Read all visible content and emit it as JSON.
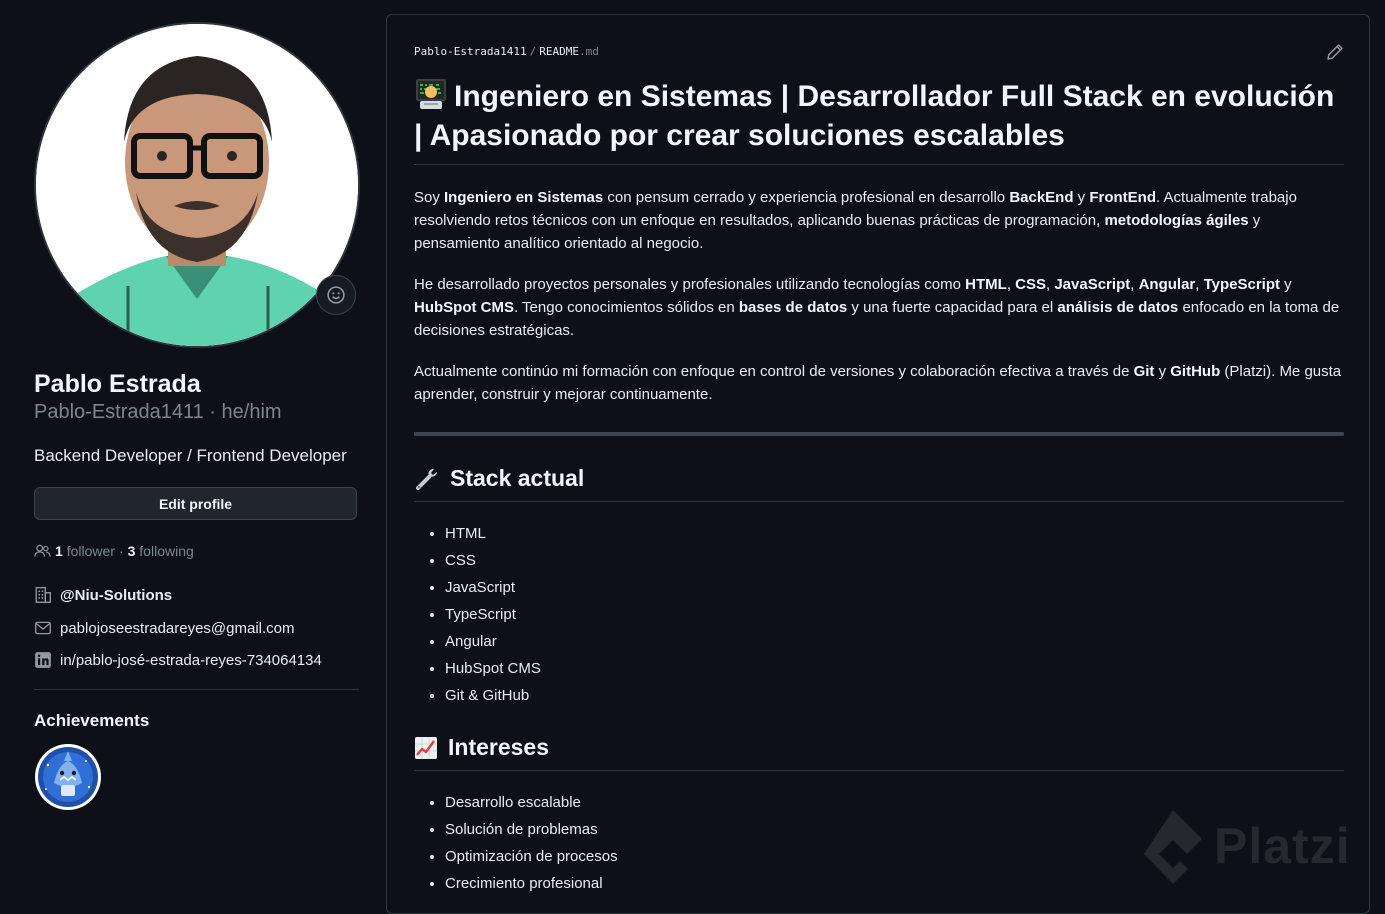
{
  "profile": {
    "name": "Pablo Estrada",
    "login_pronouns": "Pablo-Estrada1411 · he/him",
    "bio": "Backend Developer / Frontend Developer",
    "edit_button": "Edit profile",
    "followers_count": "1",
    "followers_label": "follower",
    "separator": "·",
    "following_count": "3",
    "following_label": "following",
    "organization": "@Niu-Solutions",
    "email": "pablojoseestradareyes@gmail.com",
    "linkedin": "in/pablo-josé-estrada-reyes-734064134",
    "achievements_title": "Achievements"
  },
  "readme": {
    "crumb_owner": "Pablo-Estrada1411",
    "crumb_sep": "/",
    "crumb_file": "README",
    "crumb_ext": ".md",
    "title": "Ingeniero en Sistemas | Desarrollador Full Stack en evolución | Apasionado por crear soluciones escalables",
    "para1": {
      "t1": "Soy ",
      "b1": "Ingeniero en Sistemas",
      "t2": " con pensum cerrado y experiencia profesional en desarrollo ",
      "b2": "BackEnd",
      "t3": " y ",
      "b3": "FrontEnd",
      "t4": ". Actualmente trabajo resolviendo retos técnicos con un enfoque en resultados, aplicando buenas prácticas de programación, ",
      "b4": "metodologías ágiles",
      "t5": " y pensamiento analítico orientado al negocio."
    },
    "para2": {
      "t1": "He desarrollado proyectos personales y profesionales utilizando tecnologías como ",
      "b1": "HTML",
      "t2": ", ",
      "b2": "CSS",
      "t3": ", ",
      "b3": "JavaScript",
      "t4": ", ",
      "b4": "Angular",
      "t5": ", ",
      "b5": "TypeScript",
      "t6": " y ",
      "b6": "HubSpot CMS",
      "t7": ". Tengo conocimientos sólidos en ",
      "b7": "bases de datos",
      "t8": " y una fuerte capacidad para el ",
      "b8": "análisis de datos",
      "t9": " enfocado en la toma de decisiones estratégicas."
    },
    "para3": {
      "t1": "Actualmente continúo mi formación con enfoque en control de versiones y colaboración efectiva a través de ",
      "b1": "Git",
      "t2": " y ",
      "b2": "GitHub",
      "t3": " (Platzi). Me gusta aprender, construir y mejorar continuamente."
    },
    "stack_title": "Stack actual",
    "stack": [
      "HTML",
      "CSS",
      "JavaScript",
      "TypeScript",
      "Angular",
      "HubSpot CMS",
      "Git & GitHub"
    ],
    "interests_title": "Intereses",
    "interests": [
      "Desarrollo escalable",
      "Solución de problemas",
      "Optimización de procesos",
      "Crecimiento profesional"
    ]
  },
  "watermark": "Platzi",
  "icons": {
    "smiley": "smiley-icon",
    "people": "people-icon",
    "building": "organization-icon",
    "mail": "mail-icon",
    "linkedin": "linkedin-icon",
    "pencil": "pencil-icon",
    "technologist": "technologist-emoji",
    "wrench": "wrench-emoji",
    "chart": "chart-increasing-emoji"
  },
  "colors": {
    "background": "#0d1117",
    "border": "#30363d",
    "text": "#e6edf3",
    "muted": "#7d8590",
    "shirt": "#5fd3b0"
  }
}
